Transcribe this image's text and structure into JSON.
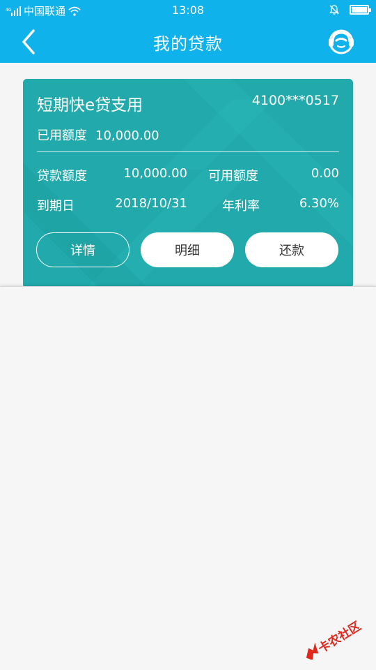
{
  "status_bar": {
    "carrier": "中国联通",
    "time": "13:08"
  },
  "header": {
    "title": "我的贷款"
  },
  "loan_card": {
    "product_name": "短期快e贷支用",
    "account": "4100***0517",
    "used_amount_label": "已用额度",
    "used_amount": "10,000.00",
    "loan_amount_label": "贷款额度",
    "loan_amount": "10,000.00",
    "available_label": "可用额度",
    "available": "0.00",
    "due_date_label": "到期日",
    "due_date": "2018/10/31",
    "rate_label": "年利率",
    "rate": "6.30%",
    "buttons": {
      "detail": "详情",
      "breakdown": "明细",
      "repay": "还款"
    }
  },
  "watermark": {
    "text": "卡农社区"
  },
  "colors": {
    "header": "#0fb2ea",
    "card": "#21a9ab"
  }
}
